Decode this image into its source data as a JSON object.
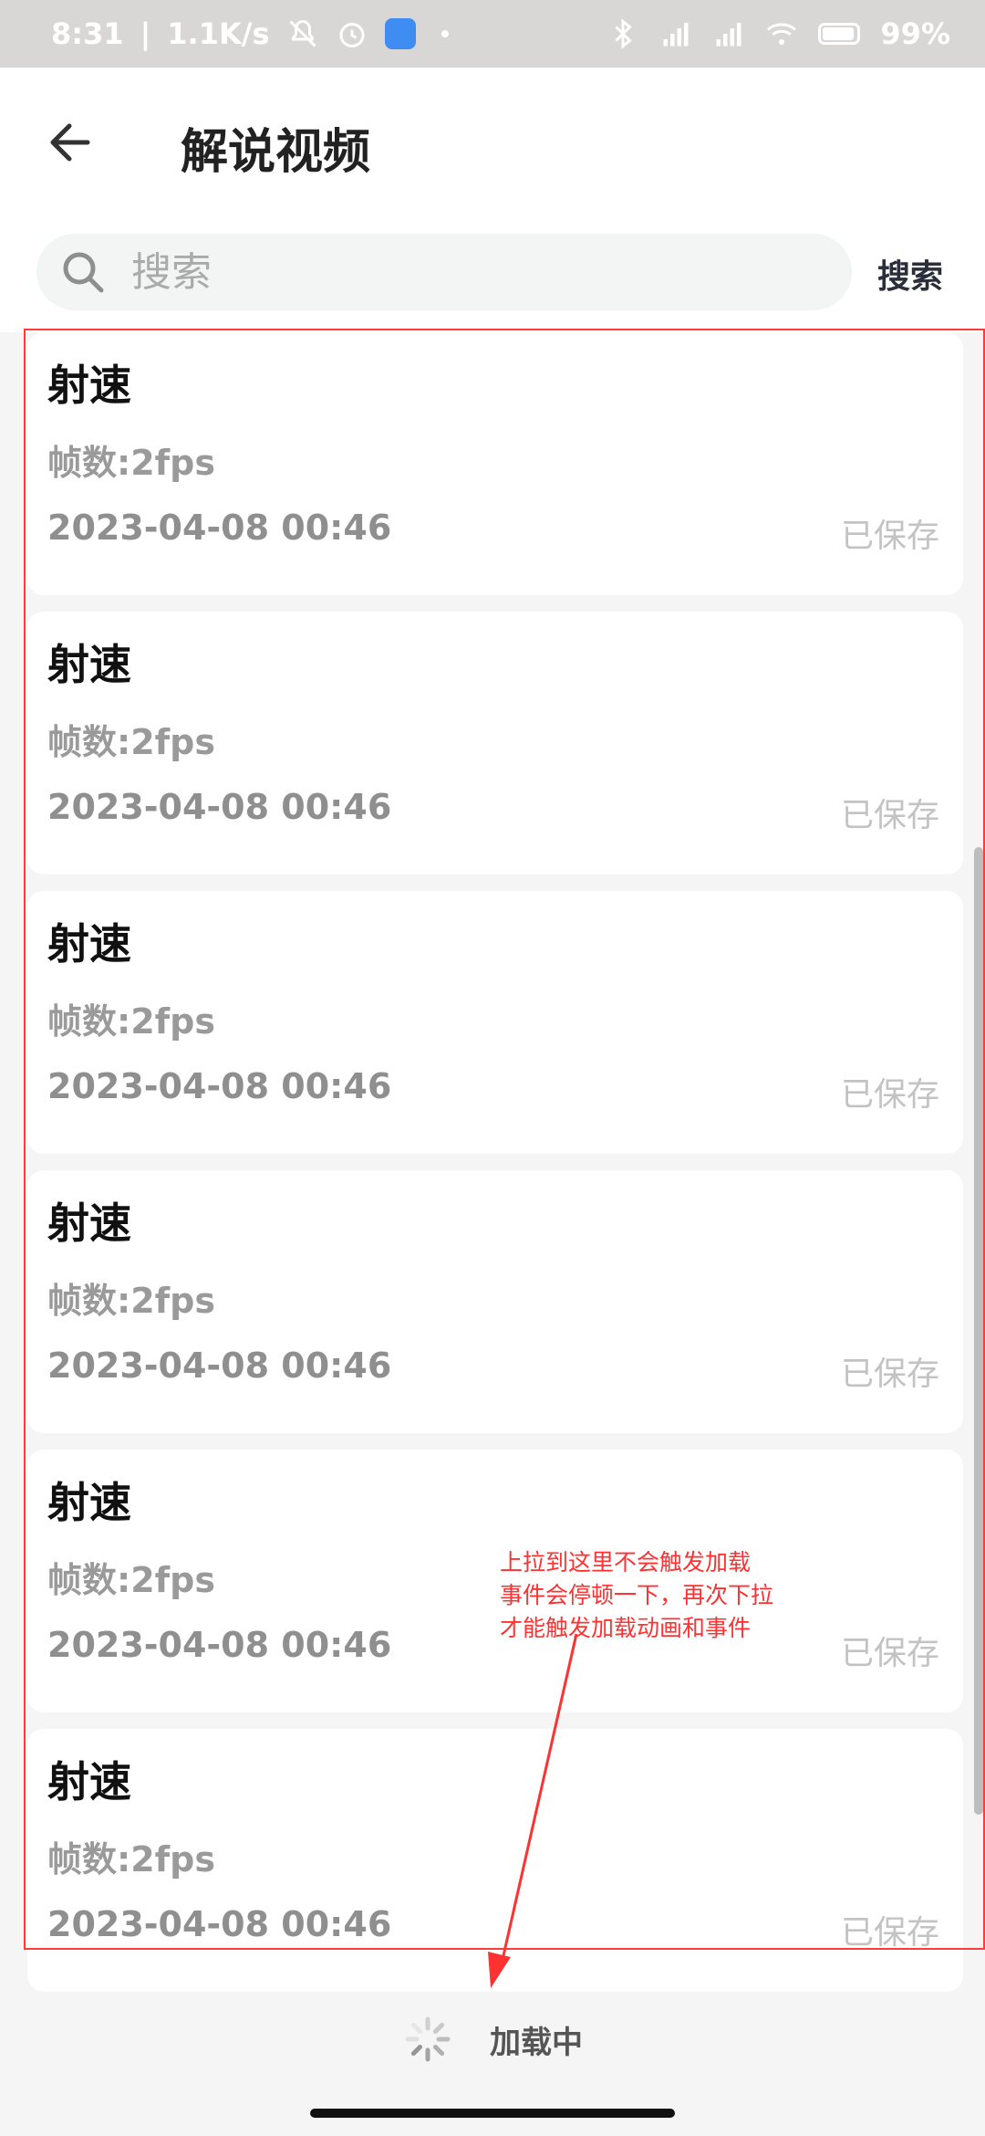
{
  "status_bar": {
    "time": "8:31",
    "network_speed": "1.1K/s",
    "battery_percent": "99%",
    "icons": [
      "mute-icon",
      "alarm-icon",
      "app-badge-icon",
      "bluetooth-icon",
      "signal-icon",
      "signal-hd-icon",
      "wifi-icon",
      "battery-icon"
    ]
  },
  "header": {
    "title": "解说视频",
    "back_icon": "arrow-left-icon"
  },
  "search": {
    "placeholder": "搜索",
    "value": "",
    "button_label": "搜索",
    "icon": "search-icon"
  },
  "list": {
    "items": [
      {
        "title": "射速",
        "fps": "帧数:2fps",
        "date": "2023-04-08 00:46",
        "status": "已保存"
      },
      {
        "title": "射速",
        "fps": "帧数:2fps",
        "date": "2023-04-08 00:46",
        "status": "已保存"
      },
      {
        "title": "射速",
        "fps": "帧数:2fps",
        "date": "2023-04-08 00:46",
        "status": "已保存"
      },
      {
        "title": "射速",
        "fps": "帧数:2fps",
        "date": "2023-04-08 00:46",
        "status": "已保存"
      },
      {
        "title": "射速",
        "fps": "帧数:2fps",
        "date": "2023-04-08 00:46",
        "status": "已保存"
      },
      {
        "title": "射速",
        "fps": "帧数:2fps",
        "date": "2023-04-08 00:46",
        "status": "已保存"
      }
    ]
  },
  "annotation": {
    "lines": [
      "上拉到这里不会触发加载",
      "事件会停顿一下，再次下拉",
      "才能触发加载动画和事件"
    ],
    "color": "#ff3131"
  },
  "footer": {
    "loading_text": "加载中",
    "spinner_icon": "loading-spinner-icon"
  }
}
